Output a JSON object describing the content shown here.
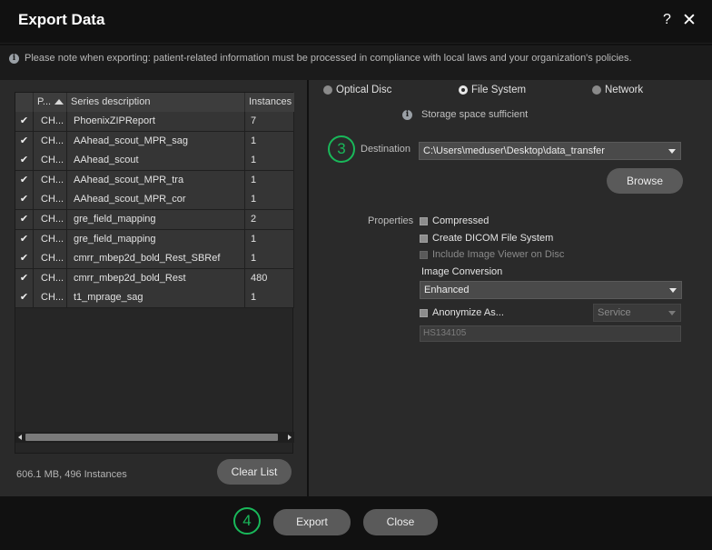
{
  "dialog": {
    "title": "Export Data",
    "help_label": "?",
    "close_label": "✕"
  },
  "notice": {
    "info_glyph": "i",
    "text": "Please note when exporting: patient-related information must be processed in compliance with local laws and your organization's policies."
  },
  "table": {
    "columns": [
      "P...",
      "Series description",
      "Instances"
    ],
    "sort_column": "P...",
    "sort_direction": "ascending",
    "rows": [
      {
        "checked": "✔",
        "p": "CH...",
        "desc": "PhoenixZIPReport",
        "inst": "7"
      },
      {
        "checked": "✔",
        "p": "CH...",
        "desc": "AAhead_scout_MPR_sag",
        "inst": "1"
      },
      {
        "checked": "✔",
        "p": "CH...",
        "desc": "AAhead_scout",
        "inst": "1"
      },
      {
        "checked": "✔",
        "p": "CH...",
        "desc": "AAhead_scout_MPR_tra",
        "inst": "1"
      },
      {
        "checked": "✔",
        "p": "CH...",
        "desc": "AAhead_scout_MPR_cor",
        "inst": "1"
      },
      {
        "checked": "✔",
        "p": "CH...",
        "desc": "gre_field_mapping",
        "inst": "2"
      },
      {
        "checked": "✔",
        "p": "CH...",
        "desc": "gre_field_mapping",
        "inst": "1"
      },
      {
        "checked": "✔",
        "p": "CH...",
        "desc": "cmrr_mbep2d_bold_Rest_SBRef",
        "inst": "1"
      },
      {
        "checked": "✔",
        "p": "CH...",
        "desc": "cmrr_mbep2d_bold_Rest",
        "inst": "480"
      },
      {
        "checked": "✔",
        "p": "CH...",
        "desc": "t1_mprage_sag",
        "inst": "1"
      }
    ]
  },
  "summary": "606.1 MB, 496 Instances",
  "clear_list_label": "Clear List",
  "targets": {
    "optical_disc": "Optical Disc",
    "file_system": "File System",
    "network": "Network",
    "selected": "File System"
  },
  "storage": {
    "info_glyph": "i",
    "text": "Storage space sufficient"
  },
  "destination": {
    "step": "3",
    "label": "Destination",
    "value": "C:\\Users\\meduser\\Desktop\\data_transfer",
    "browse_label": "Browse"
  },
  "properties": {
    "label": "Properties",
    "compressed": "Compressed",
    "create_dicom": "Create DICOM File System",
    "include_viewer": "Include Image Viewer on Disc",
    "image_conversion_label": "Image Conversion",
    "image_conversion_value": "Enhanced",
    "anonymize": "Anonymize As...",
    "service_value": "Service",
    "anonymize_id": "HS134105"
  },
  "footer": {
    "step": "4",
    "export_label": "Export",
    "close_label": "Close"
  },
  "colors": {
    "accent_green": "#19b85a",
    "panel": "#2a2a2a",
    "background": "#111111"
  }
}
